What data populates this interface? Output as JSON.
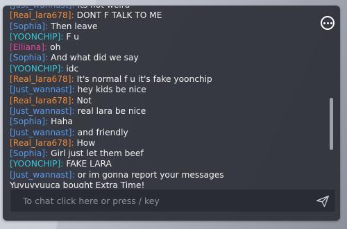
{
  "colors": {
    "username_blue": "#5b9bea",
    "username_orange": "#f08c3c",
    "username_cyan": "#37c6d8",
    "username_pink": "#e0479e",
    "text": "#f2f2f2"
  },
  "icons": {
    "menu": "more-horizontal-icon",
    "send": "send-paper-plane-icon"
  },
  "chat": {
    "messages": [
      {
        "user": "[Just_wannast]:",
        "color": "#5b9bea",
        "text": "its not weird"
      },
      {
        "user": "[Real_lara678]:",
        "color": "#f08c3c",
        "text": "DONT F TALK TO ME"
      },
      {
        "user": "[Sophia]:",
        "color": "#5b9bea",
        "text": "Then leave"
      },
      {
        "user": "[YOONCHIP]:",
        "color": "#37c6d8",
        "text": "F u"
      },
      {
        "user": "[Elliana]:",
        "color": "#e0479e",
        "text": "oh"
      },
      {
        "user": "[Sophia]:",
        "color": "#5b9bea",
        "text": "And what did we say"
      },
      {
        "user": "[YOONCHIP]:",
        "color": "#37c6d8",
        "text": "idc"
      },
      {
        "user": "[Real_lara678]:",
        "color": "#f08c3c",
        "text": "It's normal f u it's fake yoonchip"
      },
      {
        "user": "[Just_wannast]:",
        "color": "#5b9bea",
        "text": "hey kids be nice"
      },
      {
        "user": "[Real_lara678]:",
        "color": "#f08c3c",
        "text": "Not"
      },
      {
        "user": "[Just_wannast]:",
        "color": "#5b9bea",
        "text": "real lara be nice"
      },
      {
        "user": "[Sophia]:",
        "color": "#5b9bea",
        "text": "Haha"
      },
      {
        "user": "[Just_wannast]:",
        "color": "#5b9bea",
        "text": "and friendly"
      },
      {
        "user": "[Real_lara678]:",
        "color": "#f08c3c",
        "text": "How"
      },
      {
        "user": "[Sophia]:",
        "color": "#5b9bea",
        "text": "Girl just let them beef"
      },
      {
        "user": "[YOONCHIP]:",
        "color": "#37c6d8",
        "text": "FAKE LARA"
      },
      {
        "user": "[Just_wannast]:",
        "color": "#5b9bea",
        "text": "or im gonna report your messages"
      },
      {
        "user": "",
        "color": "#f2f2f2",
        "text": "Yuyuyyuuca bought Extra Time!"
      }
    ],
    "input": {
      "placeholder": "To chat click here or press / key",
      "value": ""
    }
  }
}
